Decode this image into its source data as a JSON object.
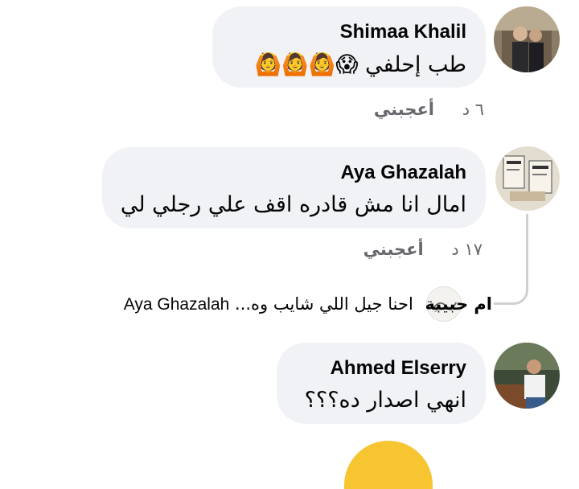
{
  "comments": [
    {
      "author": "Shimaa Khalil",
      "text": "طب إحلفي",
      "emojis": [
        "😱",
        "🙆",
        "🙆",
        "🙆"
      ],
      "time": "٦ د",
      "like_label": "أعجبني"
    },
    {
      "author": "Aya Ghazalah",
      "text": "امال انا مش قادره اقف علي رجلي لي",
      "time": "١٧ د",
      "like_label": "أعجبني"
    },
    {
      "author": "Ahmed Elserry",
      "text": "انهي اصدار ده؟؟؟"
    }
  ],
  "reply_preview": {
    "author": "ام حبيبة",
    "text": "احنا جيل اللي شايب وه...",
    "mention": "Aya Ghazalah"
  },
  "colors": {
    "bubble": "#f0f2f5",
    "meta": "#65676b",
    "text": "#050505",
    "thread_line": "#ced0d4"
  }
}
